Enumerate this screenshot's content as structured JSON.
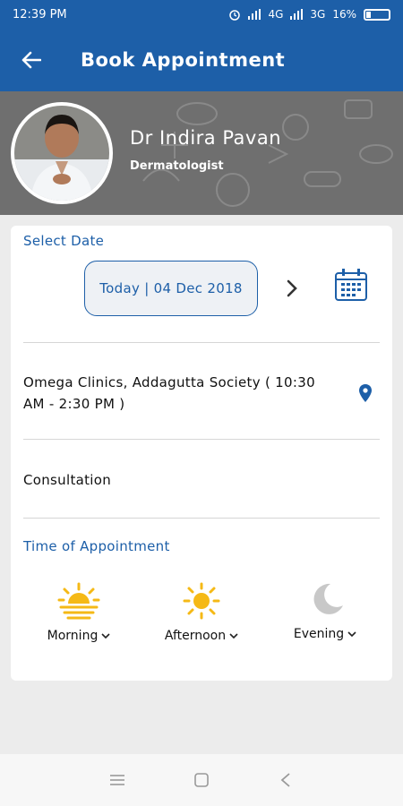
{
  "status_bar": {
    "time": "12:39 PM",
    "network": "4G",
    "network2": "3G",
    "battery": "16%"
  },
  "app_bar": {
    "title": "Book Appointment",
    "back_icon": "arrow-left-icon"
  },
  "doctor": {
    "name": "Dr Indira Pavan",
    "specialty": "Dermatologist"
  },
  "booking": {
    "select_date_label": "Select Date",
    "date_value": "Today | 04 Dec 2018",
    "clinic_info": "Omega Clinics, Addagutta Society ( 10:30 AM - 2:30 PM )",
    "consultation_label": "Consultation",
    "time_label": "Time of Appointment",
    "slots": [
      {
        "label": "Morning",
        "icon": "sunrise-icon"
      },
      {
        "label": "Afternoon",
        "icon": "sun-icon"
      },
      {
        "label": "Evening",
        "icon": "moon-icon"
      }
    ]
  },
  "colors": {
    "primary": "#1d5fa8",
    "sun": "#f5b916",
    "moon": "#c8c8c8"
  }
}
